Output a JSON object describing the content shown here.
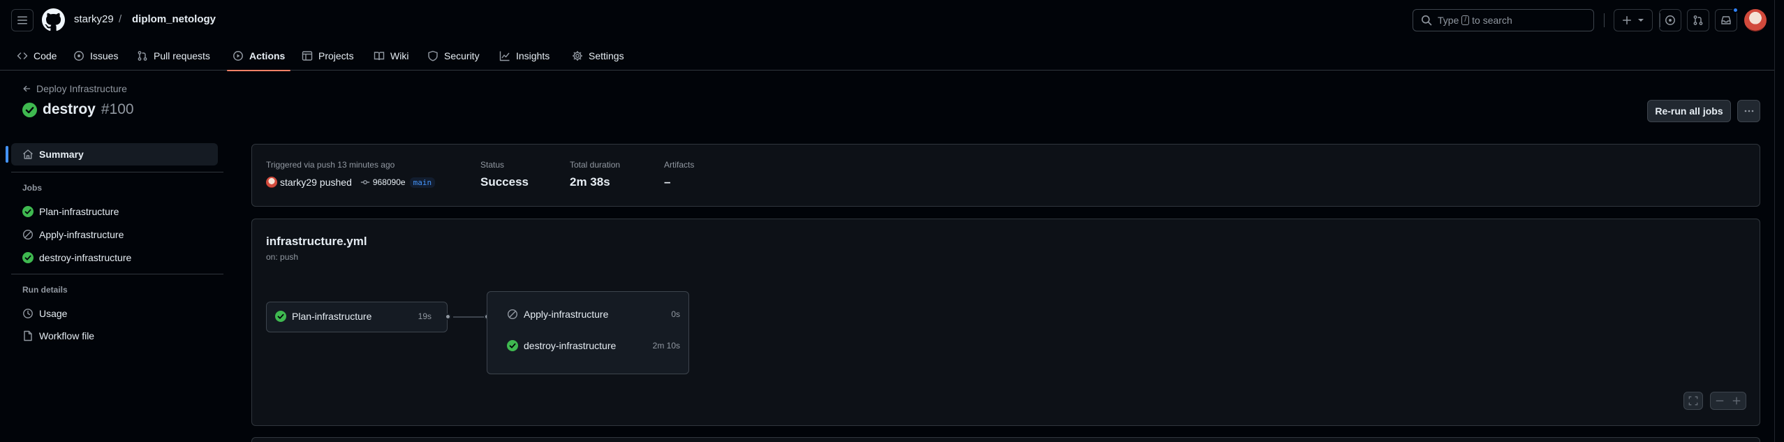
{
  "header": {
    "owner": "starky29",
    "separator": "/",
    "repo": "diplom_netology",
    "search": {
      "prefix": "Type",
      "key": "/",
      "suffix": "to search"
    }
  },
  "nav": {
    "tabs": [
      {
        "label": "Code",
        "icon": "code-icon"
      },
      {
        "label": "Issues",
        "icon": "issue-icon"
      },
      {
        "label": "Pull requests",
        "icon": "pull-request-icon"
      },
      {
        "label": "Actions",
        "icon": "play-icon",
        "active": true
      },
      {
        "label": "Projects",
        "icon": "table-icon"
      },
      {
        "label": "Wiki",
        "icon": "book-icon"
      },
      {
        "label": "Security",
        "icon": "shield-icon"
      },
      {
        "label": "Insights",
        "icon": "graph-icon"
      },
      {
        "label": "Settings",
        "icon": "gear-icon"
      }
    ]
  },
  "run": {
    "back_label": "Deploy Infrastructure",
    "title": "destroy",
    "number": "#100",
    "rerun_label": "Re-run all jobs"
  },
  "sidebar": {
    "summary_label": "Summary",
    "jobs_heading": "Jobs",
    "jobs": [
      {
        "label": "Plan-infrastructure",
        "status": "success"
      },
      {
        "label": "Apply-infrastructure",
        "status": "skipped"
      },
      {
        "label": "destroy-infrastructure",
        "status": "success"
      }
    ],
    "details_heading": "Run details",
    "details": [
      {
        "label": "Usage",
        "icon": "clock-icon"
      },
      {
        "label": "Workflow file",
        "icon": "file-icon"
      }
    ]
  },
  "summary": {
    "trigger_label": "Triggered via push 13 minutes ago",
    "actor": "starky29",
    "action": "pushed",
    "commit": "968090e",
    "branch": "main",
    "status_label": "Status",
    "status_value": "Success",
    "duration_label": "Total duration",
    "duration_value": "2m 38s",
    "artifacts_label": "Artifacts",
    "artifacts_value": "–"
  },
  "workflow": {
    "file": "infrastructure.yml",
    "trigger": "on: push",
    "jobs": [
      {
        "label": "Plan-infrastructure",
        "duration": "19s",
        "status": "success"
      },
      {
        "label": "Apply-infrastructure",
        "duration": "0s",
        "status": "skipped"
      },
      {
        "label": "destroy-infrastructure",
        "duration": "2m 10s",
        "status": "success"
      }
    ]
  },
  "colors": {
    "success": "#3fb950",
    "accent": "#4493f8",
    "active_tab_underline": "#f78166"
  }
}
